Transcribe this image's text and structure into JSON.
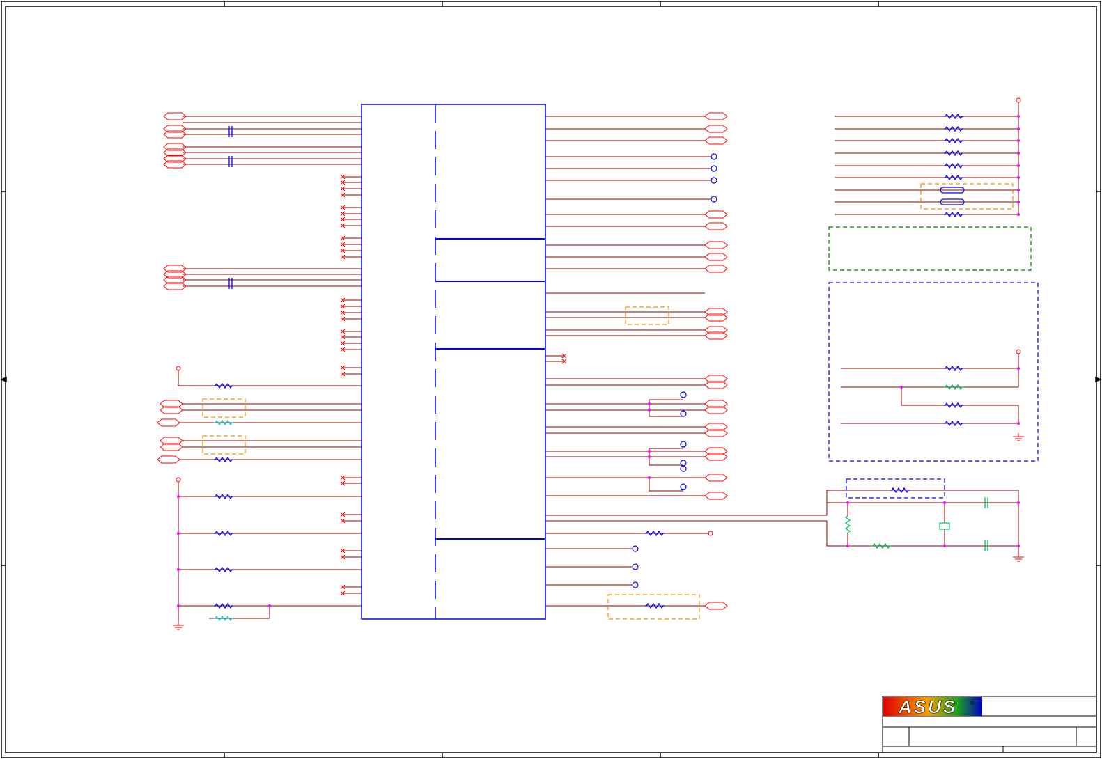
{
  "logo": {
    "text": "ASUS",
    "mark": "®"
  },
  "colors": {
    "wire": "#8b0000",
    "net": "#ff0000",
    "chip": "#0000ff",
    "junction": "#ff00ff",
    "resistor": "#0000ff",
    "resistor_alt": "#00c8c8",
    "resistor_green": "#00c060",
    "dashed_orange": "#ff8c00",
    "dashed_green": "#008000",
    "dashed_blue": "#0000ff",
    "frame": "#000000"
  }
}
